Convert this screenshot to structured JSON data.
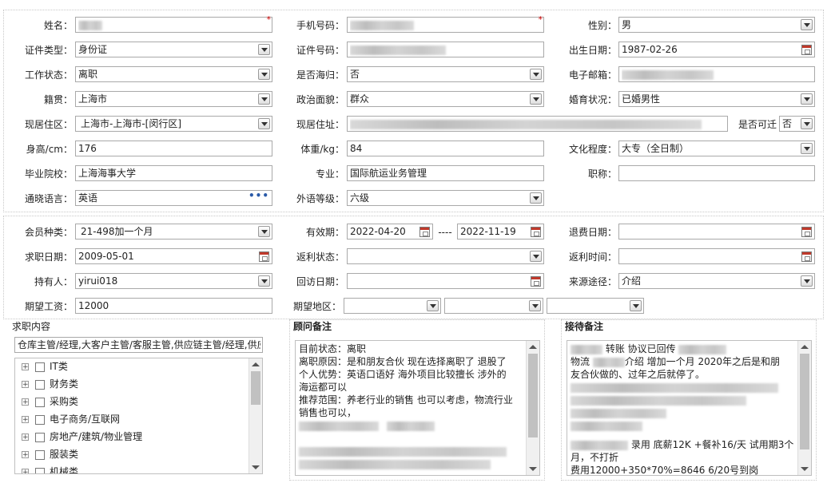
{
  "personal": {
    "name": {
      "label": "姓名："
    },
    "phone": {
      "label": "手机号码："
    },
    "gender": {
      "label": "性别：",
      "value": "男"
    },
    "id_type": {
      "label": "证件类型：",
      "value": "身份证"
    },
    "id_number": {
      "label": "证件号码："
    },
    "birth_date": {
      "label": "出生日期：",
      "value": "1987-02-26"
    },
    "work_status": {
      "label": "工作状态：",
      "value": "离职"
    },
    "overseas": {
      "label": "是否海归：",
      "value": "否"
    },
    "email": {
      "label": "电子邮箱："
    },
    "native_place": {
      "label": "籍贯：",
      "value": "上海市"
    },
    "political": {
      "label": "政治面貌：",
      "value": "群众"
    },
    "marital": {
      "label": "婚育状况：",
      "value": "已婚男性"
    },
    "district": {
      "label": "现居住区：",
      "value": "上海市-上海市-[闵行区]"
    },
    "address": {
      "label": "现居住址："
    },
    "relocate": {
      "label": "是否可迁",
      "value": "否"
    },
    "height": {
      "label": "身高/cm：",
      "value": "176"
    },
    "weight": {
      "label": "体重/kg：",
      "value": "84"
    },
    "education": {
      "label": "文化程度：",
      "value": "大专（全日制）"
    },
    "school": {
      "label": "毕业院校：",
      "value": "上海海事大学"
    },
    "major": {
      "label": "专业：",
      "value": "国际航运业务管理"
    },
    "title": {
      "label": "职称："
    },
    "language": {
      "label": "通晓语言：",
      "value": "英语"
    },
    "lang_level": {
      "label": "外语等级：",
      "value": "六级"
    }
  },
  "member": {
    "type": {
      "label": "会员种类：",
      "value": "21-498加一个月"
    },
    "valid": {
      "label": "有效期：",
      "from": "2022-04-20",
      "sep": "----",
      "to": "2022-11-19"
    },
    "refund_date": {
      "label": "退费日期："
    },
    "job_date": {
      "label": "求职日期：",
      "value": "2009-05-01"
    },
    "rebate_status": {
      "label": "返利状态："
    },
    "rebate_time": {
      "label": "返利时间："
    },
    "holder": {
      "label": "持有人：",
      "value": "yirui018"
    },
    "visit_date": {
      "label": "回访日期："
    },
    "source": {
      "label": "来源途径：",
      "value": "介绍"
    },
    "salary": {
      "label": "期望工资：",
      "value": "12000"
    },
    "area": {
      "label": "期望地区："
    }
  },
  "job_content": {
    "title": "求职内容",
    "selected": "仓库主管/经理,大客户主管/客服主管,供应链主管/经理,供应",
    "expander": "+",
    "tree": [
      "IT类",
      "财务类",
      "采购类",
      "电子商务/互联网",
      "房地产/建筑/物业管理",
      "服装类",
      "机械类"
    ]
  },
  "consultant": {
    "title": "顾问备注",
    "lines": [
      "目前状态：离职",
      "离职原因：是和朋友合伙 现在选择离职了  退股了",
      "个人优势：英语口语好  海外项目比较擅长 涉外的",
      "海运都可以",
      "推荐范围：养老行业的销售 也可以考虑，物流行业",
      "销售也可以，"
    ]
  },
  "reception": {
    "title": "接待备注",
    "line1": "转账  协议已回传",
    "line2a": "物流",
    "line2b": "介绍  增加一个月  2020年之后是和朋",
    "line3": "友合伙做的、过年之后就停了。",
    "line4": "录用 底薪12K +餐补16/天 试用期3个",
    "line5": "月，不打折",
    "line6": "费用12000+350*70%=8646 6/20号到岗"
  }
}
